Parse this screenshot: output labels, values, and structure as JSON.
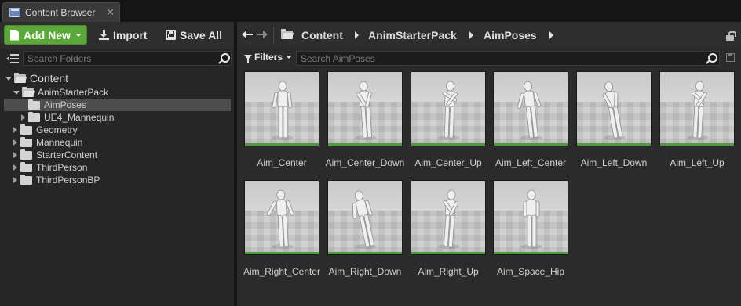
{
  "tab": {
    "title": "Content Browser",
    "icon": "content-browser-icon",
    "close": "✕"
  },
  "toolbar": {
    "add_new_label": "Add New",
    "import_label": "Import",
    "save_all_label": "Save All"
  },
  "folders": {
    "search_placeholder": "Search Folders",
    "root": "Content",
    "items": [
      {
        "label": "AnimStarterPack",
        "state": "expanded"
      },
      {
        "label": "AimPoses",
        "state": "selected"
      },
      {
        "label": "UE4_Mannequin",
        "state": "collapsed"
      },
      {
        "label": "Geometry",
        "state": "collapsed"
      },
      {
        "label": "Mannequin",
        "state": "collapsed"
      },
      {
        "label": "StarterContent",
        "state": "collapsed"
      },
      {
        "label": "ThirdPerson",
        "state": "collapsed"
      },
      {
        "label": "ThirdPersonBP",
        "state": "collapsed"
      }
    ]
  },
  "breadcrumb": [
    "Content",
    "AnimStarterPack",
    "AimPoses"
  ],
  "filters": {
    "label": "Filters",
    "search_placeholder": "Search AimPoses"
  },
  "assets": [
    {
      "name": "Aim_Center"
    },
    {
      "name": "Aim_Center_Down"
    },
    {
      "name": "Aim_Center_Up"
    },
    {
      "name": "Aim_Left_Center"
    },
    {
      "name": "Aim_Left_Down"
    },
    {
      "name": "Aim_Left_Up"
    },
    {
      "name": "Aim_Right_Center"
    },
    {
      "name": "Aim_Right_Down"
    },
    {
      "name": "Aim_Right_Up"
    },
    {
      "name": "Aim_Space_Hip"
    }
  ],
  "colors": {
    "accent_green": "#5aa83a",
    "panel_bg": "#262626",
    "selection": "#4d4d4d",
    "thumb_strip": "#4f9a3c"
  }
}
